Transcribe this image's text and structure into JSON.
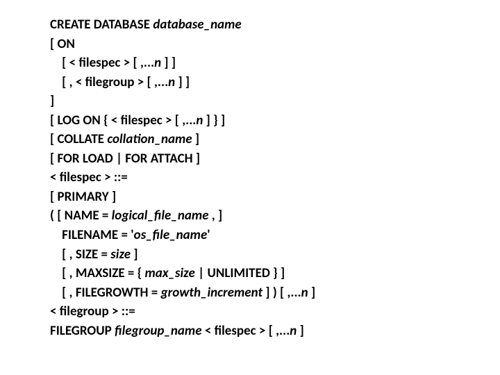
{
  "l1a": "CREATE DATABASE ",
  "l1b": "database_name",
  "l2": "[ ON",
  "l3a": "    [ < filespec > [ ,...",
  "l3b": "n",
  "l3c": " ] ]",
  "l4a": "    [ , < filegroup > [ ,...",
  "l4b": "n",
  "l4c": " ] ]",
  "l5": "]",
  "l6a": "[ LOG ON { < filespec > [ ,...",
  "l6b": "n",
  "l6c": " ] } ]",
  "l7a": "[ COLLATE ",
  "l7b": "collation_name",
  "l7c": " ]",
  "l8": "[ FOR LOAD | FOR ATTACH ]",
  "l9": "< filespec > ::=",
  "l10": "[ PRIMARY ]",
  "l11a": "( [ NAME = ",
  "l11b": "logical_file_name",
  "l11c": " , ]",
  "l12a": "    FILENAME = '",
  "l12b": "os_file_name",
  "l12c": "'",
  "l13a": "    [ , SIZE = ",
  "l13b": "size",
  "l13c": " ]",
  "l14a": "    [ , MAXSIZE = { ",
  "l14b": "max_size",
  "l14c": " | UNLIMITED } ]",
  "l15a": "    [ , FILEGROWTH = ",
  "l15b": "growth_increment",
  "l15c": " ] ) [ ,...",
  "l15d": "n",
  "l15e": " ]",
  "l16": "< filegroup > ::=",
  "l17a": "FILEGROUP ",
  "l17b": "filegroup_name",
  "l17c": " < filespec > [ ,...",
  "l17d": "n",
  "l17e": " ]"
}
